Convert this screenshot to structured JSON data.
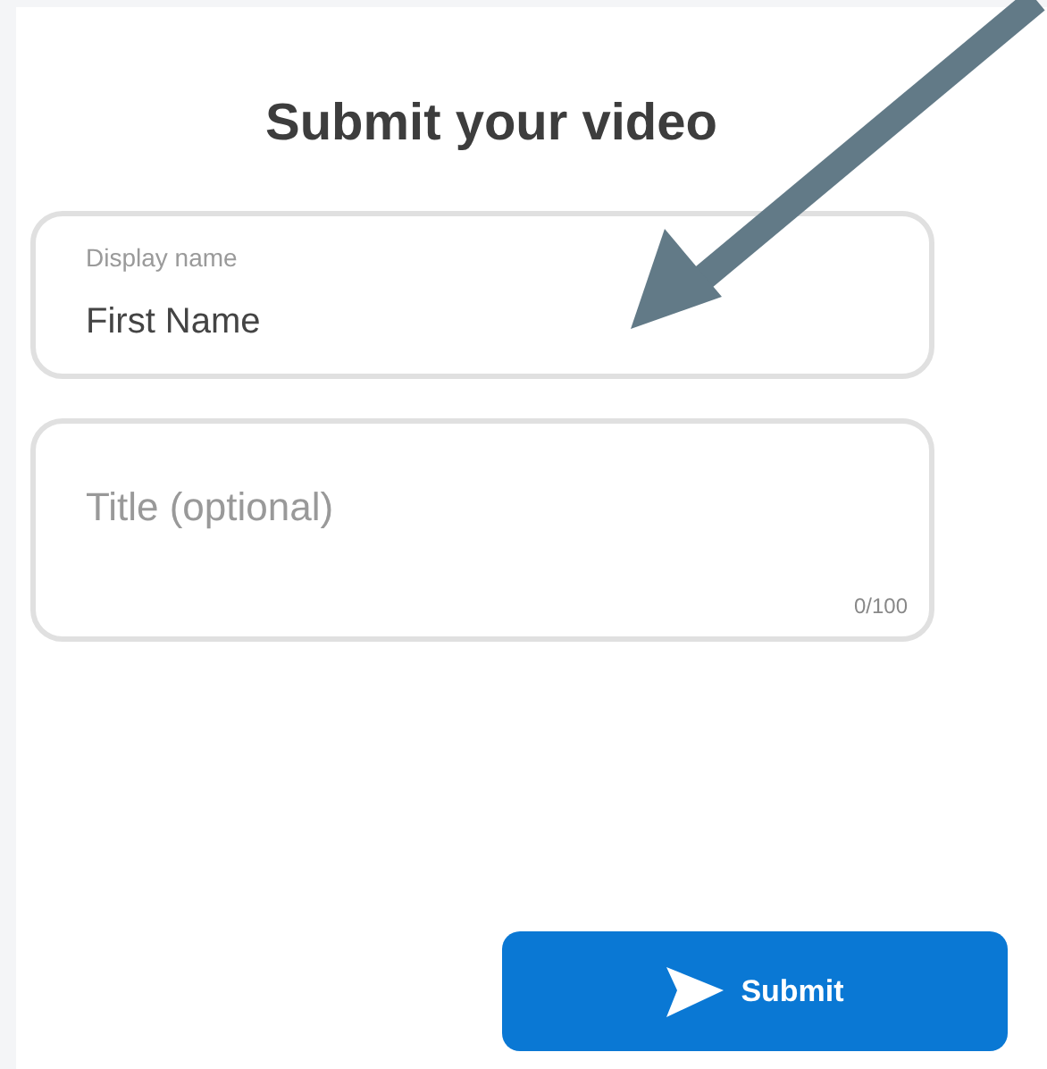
{
  "title": "Submit your video",
  "fields": [
    {
      "kind": "filled",
      "label": "Display name",
      "value": "First Name"
    },
    {
      "kind": "textarea",
      "placeholder": "Title (optional)",
      "counter": "0/100"
    }
  ],
  "submit_button": {
    "label": "Submit"
  }
}
